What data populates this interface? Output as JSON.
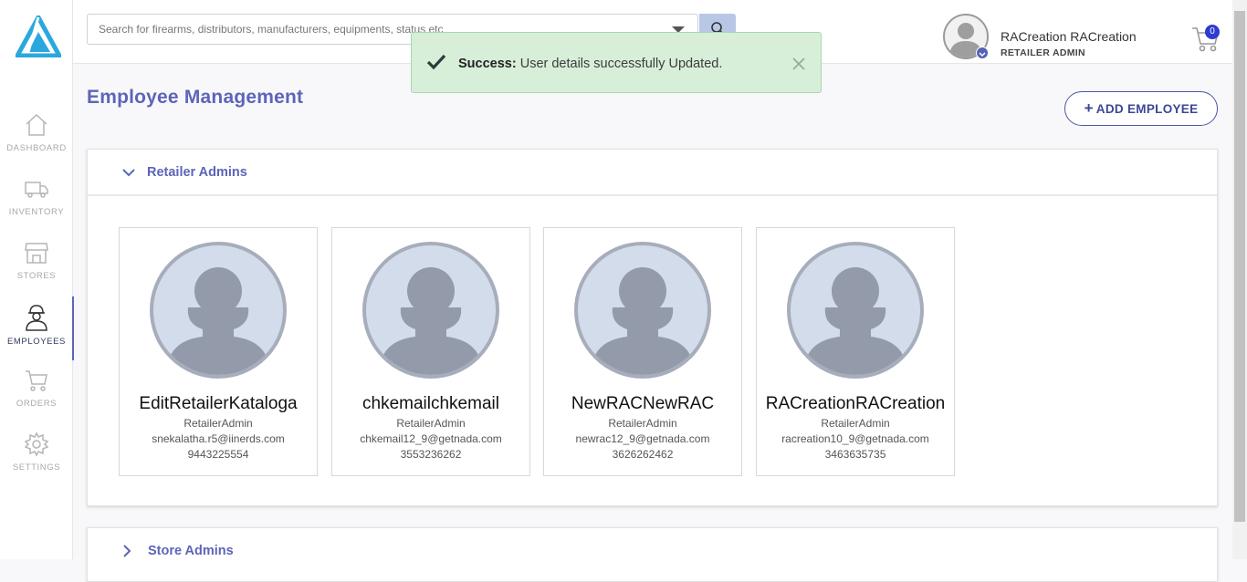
{
  "colors": {
    "accent": "#5c65b8",
    "success_bg": "#d7efd9",
    "cart_badge": "#2e3bd0",
    "avatar_bg": "#d3dcea"
  },
  "sidebar": {
    "logo": "app-logo",
    "items": [
      {
        "label": "DASHBOARD",
        "icon": "home-icon",
        "active": false
      },
      {
        "label": "INVENTORY",
        "icon": "truck-icon",
        "active": false
      },
      {
        "label": "STORES",
        "icon": "store-icon",
        "active": false
      },
      {
        "label": "EMPLOYEES",
        "icon": "employee-icon",
        "active": true
      },
      {
        "label": "ORDERS",
        "icon": "cart-icon",
        "active": false
      },
      {
        "label": "SETTINGS",
        "icon": "gear-icon",
        "active": false
      }
    ]
  },
  "search": {
    "placeholder": "Search for firearms, distributors, manufacturers, equipments, status etc"
  },
  "user": {
    "name": "RACreation RACreation",
    "role": "RETAILER ADMIN"
  },
  "cart": {
    "count": "0"
  },
  "toast": {
    "title": "Success:",
    "message": "User details successfully Updated."
  },
  "page": {
    "title": "Employee Management",
    "add_button": "ADD EMPLOYEE"
  },
  "sections": [
    {
      "title": "Retailer Admins",
      "expanded": true,
      "employees": [
        {
          "name": "EditRetailerKataloga",
          "role": "RetailerAdmin",
          "email": "snekalatha.r5@iinerds.com",
          "phone": "9443225554"
        },
        {
          "name": "chkemailchkemail",
          "role": "RetailerAdmin",
          "email": "chkemail12_9@getnada.com",
          "phone": "3553236262"
        },
        {
          "name": "NewRACNewRAC",
          "role": "RetailerAdmin",
          "email": "newrac12_9@getnada.com",
          "phone": "3626262462"
        },
        {
          "name": "RACreationRACreation",
          "role": "RetailerAdmin",
          "email": "racreation10_9@getnada.com",
          "phone": "3463635735"
        }
      ]
    },
    {
      "title": "Store Admins",
      "expanded": false
    }
  ]
}
